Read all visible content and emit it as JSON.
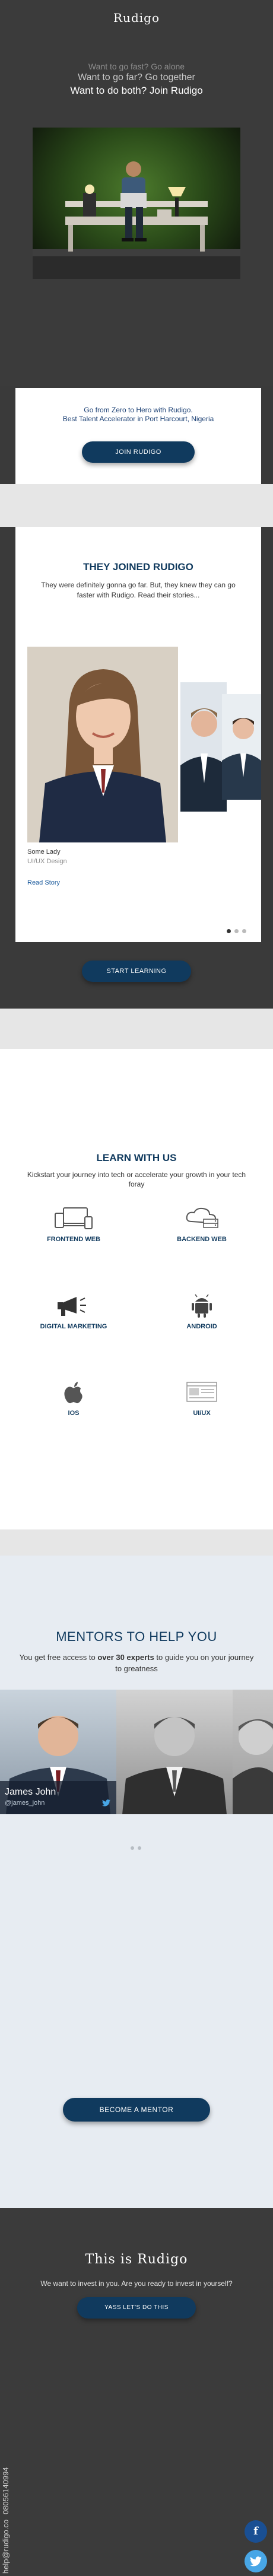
{
  "hero": {
    "brand": "Rudigo",
    "line1": "Want to go fast? Go alone",
    "line2": "Want to go far? Go together",
    "line3": "Want to do both? Join Rudigo"
  },
  "intro": {
    "line1": "Go from Zero to Hero with Rudigo.",
    "line2": "Best Talent Accelerator in Port Harcourt, Nigeria",
    "button": "JOIN RUDIGO"
  },
  "joined": {
    "title": "THEY JOINED RUDIGO",
    "subtitle": "They were definitely gonna go far. But, they knew they can go faster with Rudigo. Read their stories...",
    "story": {
      "name": "Some Lady",
      "role": "UI/UX Design",
      "link": "Read Story"
    },
    "slide_count": 3,
    "active_slide": 1
  },
  "start_button": "START LEARNING",
  "learn": {
    "title": "LEARN WITH US",
    "subtitle": "Kickstart your journey into tech or accelerate your growth in your tech foray",
    "courses": [
      {
        "label": "FRONTEND WEB",
        "icon": "devices-icon"
      },
      {
        "label": "BACKEND WEB",
        "icon": "cloud-server-icon"
      },
      {
        "label": "DIGITAL MARKETING",
        "icon": "megaphone-icon"
      },
      {
        "label": "ANDROID",
        "icon": "android-icon"
      },
      {
        "label": "IOS",
        "icon": "apple-icon"
      },
      {
        "label": "UI/UX",
        "icon": "wireframe-icon"
      }
    ]
  },
  "mentors": {
    "title": "MENTORS TO HELP YOU",
    "sub_before": "You get free access to ",
    "sub_bold": "over 30 experts",
    "sub_after": " to guide you on your journey to greatness",
    "featured": {
      "name": "James John",
      "handle": "@james_john"
    },
    "button": "BECOME A MENTOR"
  },
  "footer": {
    "title": "This is Rudigo",
    "subtitle": "We want to invest in you. Are you ready to invest in yourself?",
    "button": "YASS LET'S DO THIS",
    "phone": "08056140994",
    "email": "help@rudigo.co",
    "facebook": "f"
  },
  "colors": {
    "navy": "#103a5e",
    "dark_bg": "#3a3a3a",
    "light_band": "#e6e6e6",
    "mentor_bg": "#e7ecf2",
    "facebook": "#1a4f93",
    "twitter": "#48a6e6"
  }
}
